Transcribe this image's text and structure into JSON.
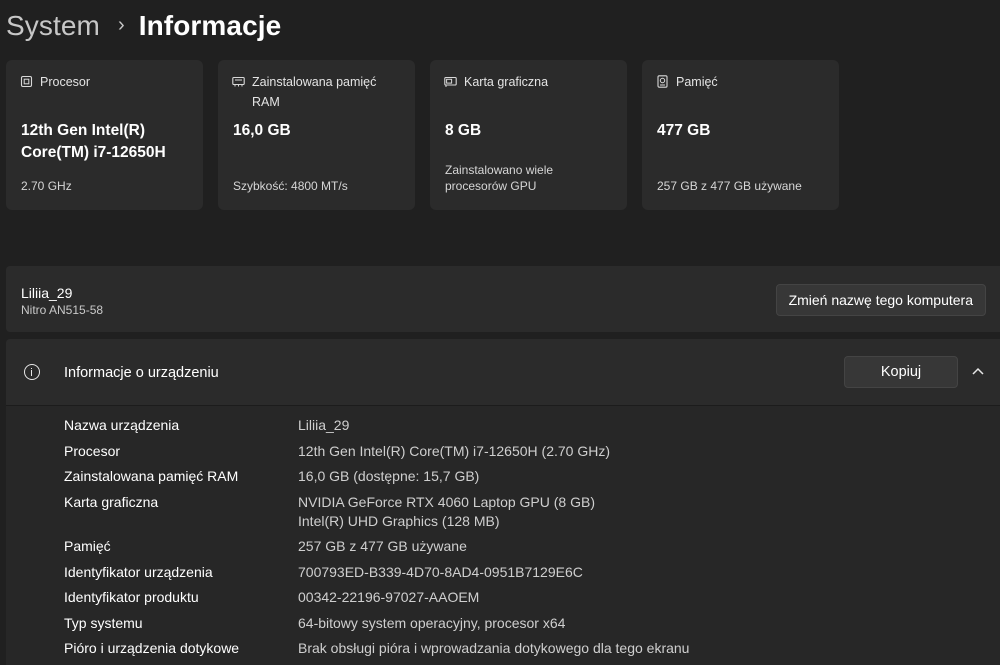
{
  "breadcrumb": {
    "parent": "System",
    "separator": "›",
    "current": "Informacje"
  },
  "cards": [
    {
      "icon": "processor-icon",
      "title": "Procesor",
      "value_line1": "12th Gen Intel(R)",
      "value_line2": "Core(TM) i7-12650H",
      "sub_line1": "2.70 GHz",
      "sub_line2": ""
    },
    {
      "icon": "memory-icon",
      "title_line1": "Zainstalowana pamięć",
      "title_line2": "RAM",
      "value_line1": "16,0 GB",
      "sub_line1": "Szybkość: 4800 MT/s"
    },
    {
      "icon": "graphics-card-icon",
      "title": "Karta graficzna",
      "value_line1": "8 GB",
      "sub_line1": "Zainstalowano wiele",
      "sub_line2": "procesorów GPU"
    },
    {
      "icon": "storage-icon",
      "title": "Pamięć",
      "value_line1": "477 GB",
      "sub_line1": "257 GB z 477 GB używane"
    }
  ],
  "device": {
    "name": "Liliia_29",
    "model": "Nitro AN515-58",
    "rename_label": "Zmień nazwę tego komputera"
  },
  "device_info": {
    "title": "Informacje o urządzeniu",
    "copy_label": "Kopiuj",
    "rows": [
      {
        "label": "Nazwa urządzenia",
        "value": "Liliia_29"
      },
      {
        "label": "Procesor",
        "value": "12th Gen Intel(R) Core(TM) i7-12650H (2.70 GHz)"
      },
      {
        "label": "Zainstalowana pamięć RAM",
        "value": "16,0 GB (dostępne: 15,7 GB)"
      },
      {
        "label": "Karta graficzna",
        "value": "NVIDIA GeForce RTX 4060 Laptop GPU (8 GB)",
        "value2": "Intel(R) UHD Graphics (128 MB)"
      },
      {
        "label": "Pamięć",
        "value": "257 GB z 477 GB używane"
      },
      {
        "label": "Identyfikator urządzenia",
        "value": "700793ED-B339-4D70-8AD4-0951B7129E6C"
      },
      {
        "label": "Identyfikator produktu",
        "value": "00342-22196-97027-AAOEM"
      },
      {
        "label": "Typ systemu",
        "value": "64-bitowy system operacyjny, procesor x64"
      },
      {
        "label": "Pióro i urządzenia dotykowe",
        "value": "Brak obsługi pióra i wprowadzania dotykowego dla tego ekranu"
      }
    ]
  },
  "colors": {
    "background": "#202020",
    "card": "#2b2b2b",
    "button": "#373737"
  }
}
